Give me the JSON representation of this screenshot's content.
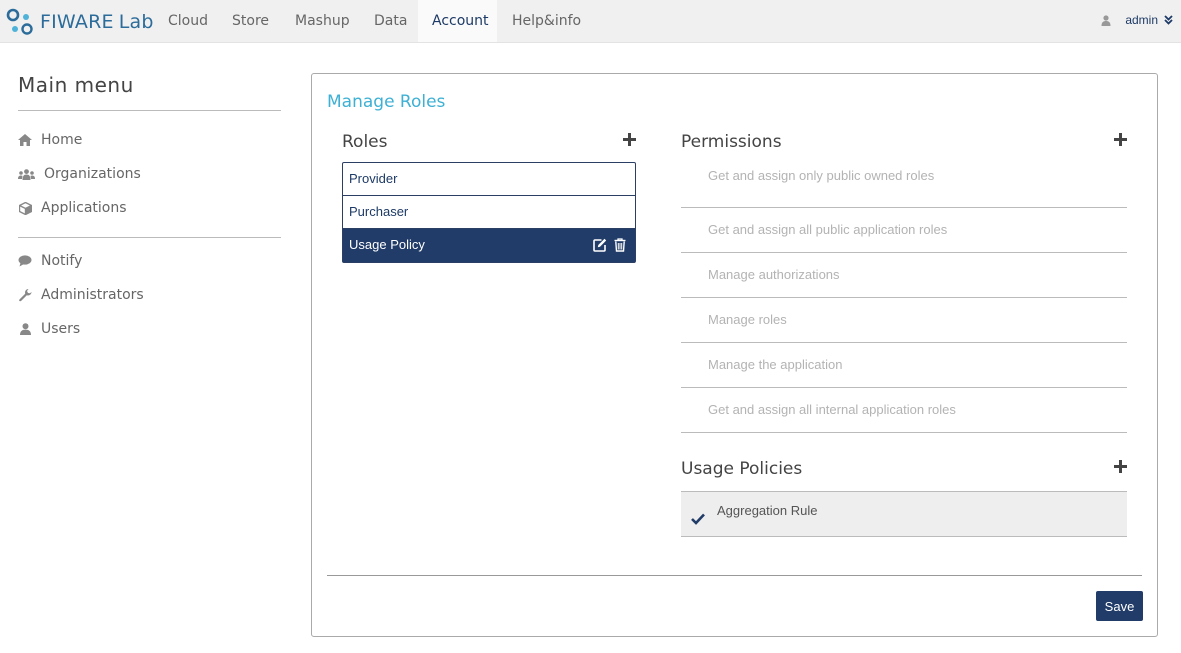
{
  "brand": {
    "name": "FIWARE",
    "suffix": "Lab"
  },
  "nav": {
    "items": [
      {
        "label": "Cloud"
      },
      {
        "label": "Store"
      },
      {
        "label": "Mashup"
      },
      {
        "label": "Data"
      },
      {
        "label": "Account",
        "active": true
      },
      {
        "label": "Help&info"
      }
    ],
    "user": {
      "name": "admin",
      "icon": "user-icon",
      "caret": "double-chevron-down-icon"
    }
  },
  "sidebar": {
    "title": "Main menu",
    "items": [
      {
        "label": "Home",
        "icon": "home-icon"
      },
      {
        "label": "Organizations",
        "icon": "users-icon"
      },
      {
        "label": "Applications",
        "icon": "cube-icon"
      },
      {
        "label": "Notify",
        "icon": "comment-icon"
      },
      {
        "label": "Administrators",
        "icon": "wrench-icon"
      },
      {
        "label": "Users",
        "icon": "user-icon"
      }
    ]
  },
  "main": {
    "title": "Manage Roles",
    "roles": {
      "header": "Roles",
      "items": [
        {
          "label": "Provider"
        },
        {
          "label": "Purchaser"
        },
        {
          "label": "Usage Policy",
          "selected": true
        }
      ]
    },
    "permissions": {
      "header": "Permissions",
      "items": [
        {
          "label": "Get and assign only public owned roles"
        },
        {
          "label": "Get and assign all public application roles"
        },
        {
          "label": "Manage authorizations"
        },
        {
          "label": "Manage roles"
        },
        {
          "label": "Manage the application"
        },
        {
          "label": "Get and assign all internal application roles"
        }
      ]
    },
    "usage_policies": {
      "header": "Usage Policies",
      "items": [
        {
          "label": "Aggregation Rule",
          "checked": true
        }
      ]
    },
    "save_label": "Save"
  },
  "colors": {
    "accent_title": "#3db0d4",
    "primary_dark": "#213c68",
    "muted_text": "#b3b3b3",
    "topbar_bg": "#f0f0f0"
  }
}
